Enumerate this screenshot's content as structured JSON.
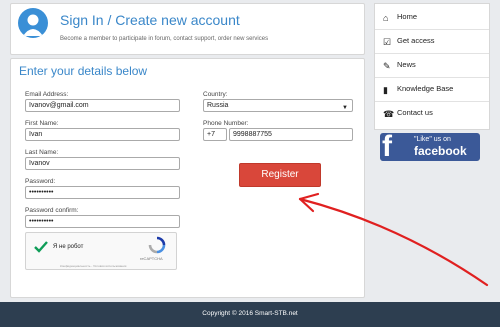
{
  "header": {
    "title": "Sign In / Create new account",
    "subtitle": "Become a member to participate in forum, contact support, order new services"
  },
  "form": {
    "title": "Enter your details below",
    "email": {
      "label": "Email Address:",
      "value": "Ivanov@gmail.com"
    },
    "first_name": {
      "label": "First Name:",
      "value": "Ivan"
    },
    "last_name": {
      "label": "Last Name:",
      "value": "Ivanov"
    },
    "password": {
      "label": "Password:",
      "value": "••••••••••"
    },
    "password_confirm": {
      "label": "Password confirm:",
      "value": "••••••••••"
    },
    "country": {
      "label": "Country:",
      "value": "Russia"
    },
    "phone": {
      "label": "Phone Number:",
      "code": "+7",
      "value": "9998887755"
    },
    "register_label": "Register"
  },
  "captcha": {
    "text": "Я не робот",
    "brand": "reCAPTCHA",
    "terms": "Конфиденциальность - Условия использования"
  },
  "sidebar": {
    "items": [
      {
        "label": "Home",
        "icon": "home-icon"
      },
      {
        "label": "Get access",
        "icon": "checkbox-icon"
      },
      {
        "label": "News",
        "icon": "edit-icon"
      },
      {
        "label": "Knowledge Base",
        "icon": "book-icon"
      },
      {
        "label": "Contact us",
        "icon": "phone-icon"
      }
    ]
  },
  "facebook": {
    "like_text": "\"Like\" us on",
    "brand_text": "facebook"
  },
  "footer": {
    "text": "Copyright © 2016 Smart-STB.net"
  },
  "colors": {
    "accent_blue": "#3a87c9",
    "register_red": "#d9473a",
    "annotation_red": "#e02020",
    "facebook_blue": "#3b5998",
    "footer_bg": "#2d3e50"
  }
}
